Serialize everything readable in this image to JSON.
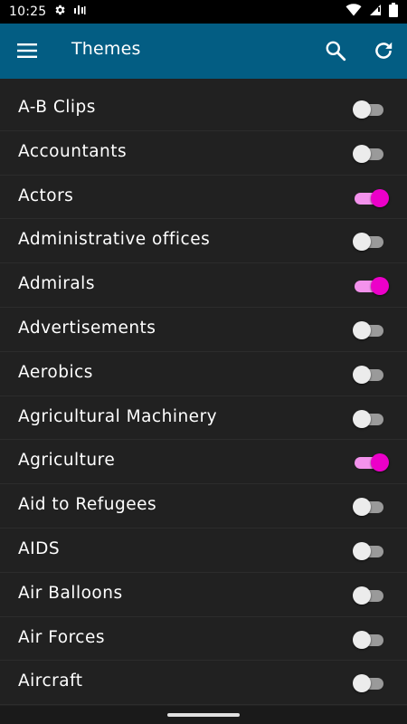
{
  "status_bar": {
    "time": "10:25",
    "icons": [
      "gear-icon",
      "signal-bars-icon",
      "wifi-icon",
      "notification-icon",
      "battery-icon"
    ]
  },
  "app_bar": {
    "title": "Themes",
    "menu_icon": "menu-icon",
    "search_icon": "search-icon",
    "refresh_icon": "refresh-icon"
  },
  "colors": {
    "app_bar": "#035d83",
    "background": "#212121",
    "switch_on_thumb": "#ec00c9",
    "switch_on_track": "#f392ec",
    "switch_off_thumb": "#ececec",
    "switch_off_track": "#9a9a9a"
  },
  "themes": [
    {
      "label": "A-B Clips",
      "enabled": false
    },
    {
      "label": "Accountants",
      "enabled": false
    },
    {
      "label": "Actors",
      "enabled": true
    },
    {
      "label": "Administrative offices",
      "enabled": false
    },
    {
      "label": "Admirals",
      "enabled": true
    },
    {
      "label": "Advertisements",
      "enabled": false
    },
    {
      "label": "Aerobics",
      "enabled": false
    },
    {
      "label": "Agricultural Machinery",
      "enabled": false
    },
    {
      "label": "Agriculture",
      "enabled": true
    },
    {
      "label": "Aid to Refugees",
      "enabled": false
    },
    {
      "label": "AIDS",
      "enabled": false
    },
    {
      "label": "Air Balloons",
      "enabled": false
    },
    {
      "label": "Air Forces",
      "enabled": false
    },
    {
      "label": "Aircraft",
      "enabled": false
    }
  ]
}
